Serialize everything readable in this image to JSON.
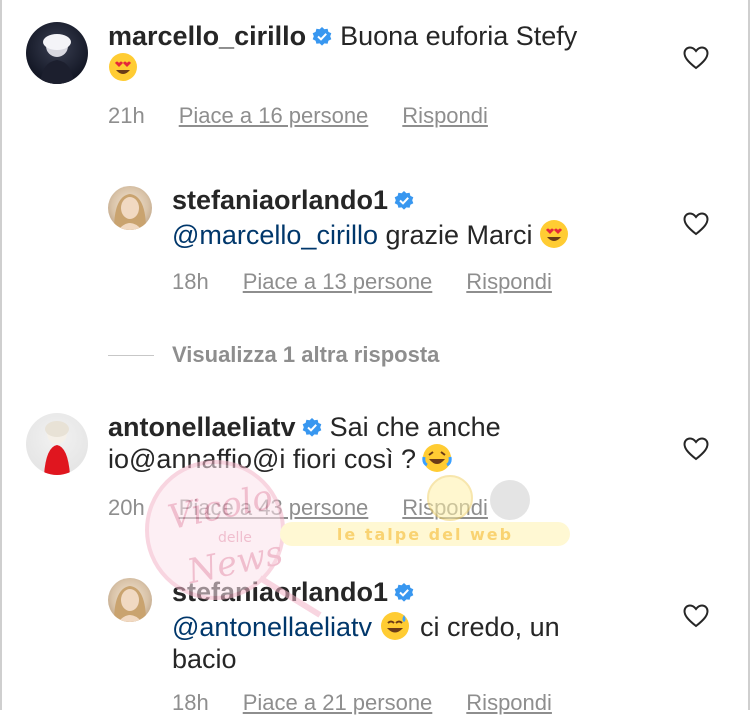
{
  "comments": [
    {
      "username": "marcello_cirillo",
      "text": "Buona  euforia Stefy",
      "time": "21h",
      "likes": "Piace a 16 persone",
      "reply": "Rispondi"
    },
    {
      "username": "stefaniaorlando1",
      "mention": "@marcello_cirillo",
      "text": "grazie Marci",
      "time": "18h",
      "likes": "Piace a 13 persone",
      "reply": "Rispondi"
    },
    {
      "username": "antonellaeliatv",
      "text_line1": "Sai che anche",
      "text_line2": "io@annaffio@i fiori così ?",
      "time": "20h",
      "likes": "Piace a 43 persone",
      "reply": "Rispondi"
    },
    {
      "username": "stefaniaorlando1",
      "mention": "@antonellaeliatv",
      "text_line1": "ci credo, un",
      "text_line2": "bacio",
      "time": "18h",
      "likes": "Piace a 21 persone",
      "reply": "Rispondi"
    }
  ],
  "more_replies": "Visualizza 1 altra risposta",
  "watermark": {
    "circle_text_1": "Vicolo",
    "circle_text_2": "delle",
    "circle_text_3": "News",
    "banner_text": "le talpe del web"
  },
  "colors": {
    "verified": "#3897f0",
    "heart": "#262626",
    "meta": "#8e8e8e",
    "mention": "#00376b"
  },
  "icons": [
    "verified-badge-icon",
    "heart-icon",
    "heart-eyes-emoji",
    "laughing-emoji",
    "sweat-smile-emoji"
  ]
}
